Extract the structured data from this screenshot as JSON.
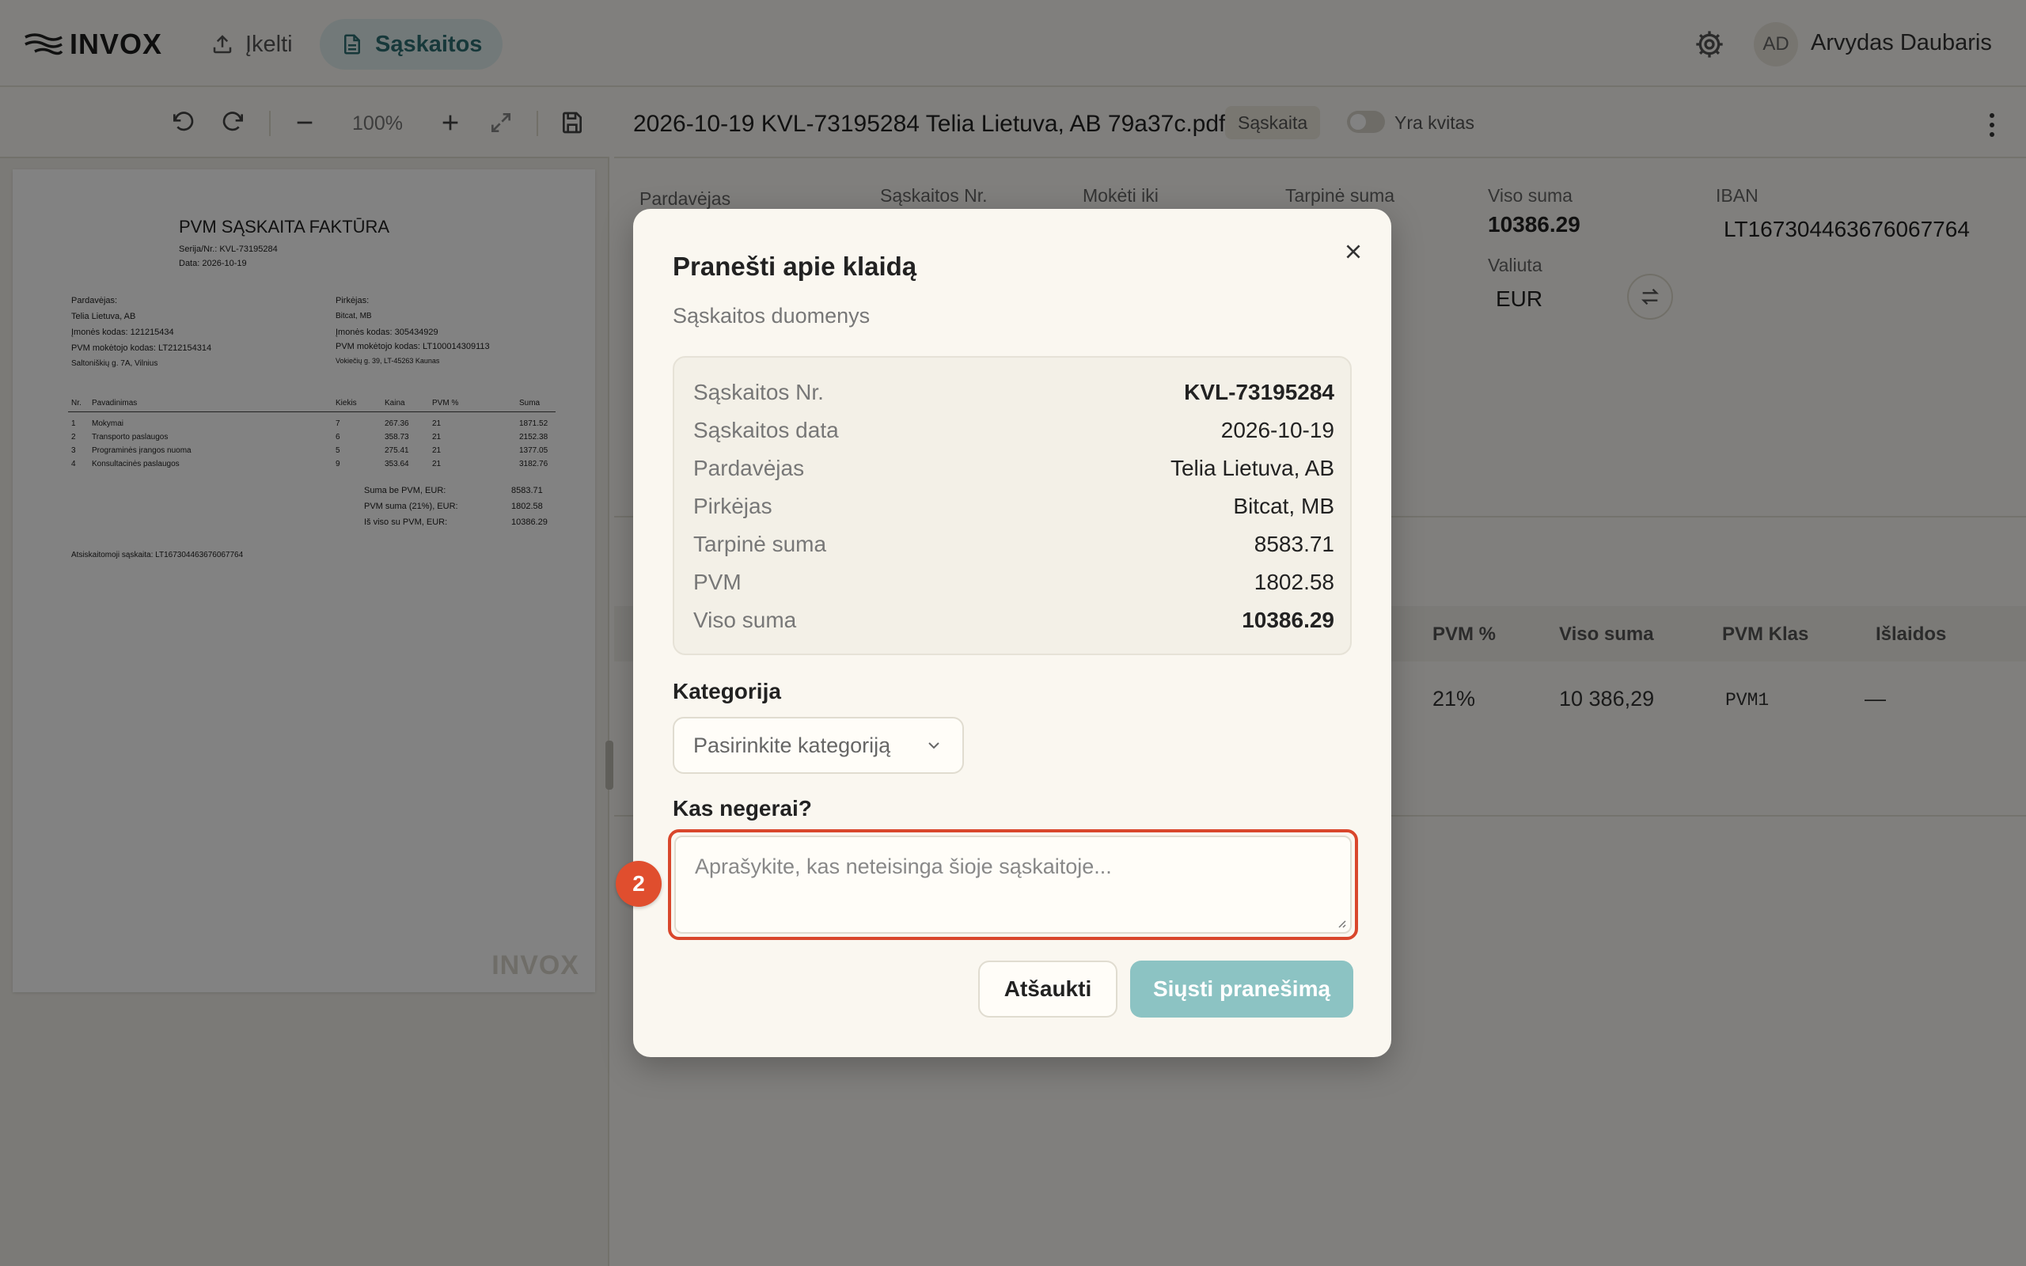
{
  "app": {
    "name": "INVOX"
  },
  "nav": {
    "upload_label": "Įkelti",
    "invoices_label": "Sąskaitos"
  },
  "user": {
    "initials": "AD",
    "name": "Arvydas Daubaris"
  },
  "viewer": {
    "zoom": "100%"
  },
  "pdf": {
    "title": "PVM SĄSKAITA FAKTŪRA",
    "series": "Serija/Nr.: KVL-73195284",
    "date": "Data: 2026-10-19",
    "seller_head": "Pardavėjas:",
    "seller_name": "Telia Lietuva, AB",
    "seller_code": "Įmonės kodas: 121215434",
    "seller_vat": "PVM mokėtojo kodas: LT212154314",
    "seller_addr": "Saltoniškių g. 7A, Vilnius",
    "buyer_head": "Pirkėjas:",
    "buyer_name": "Bitcat, MB",
    "buyer_code": "Įmonės kodas: 305434929",
    "buyer_vat": "PVM mokėtojo kodas: LT100014309113",
    "buyer_addr": "Vokiečių g. 39, LT-45263 Kaunas",
    "columns": [
      "Nr.",
      "Pavadinimas",
      "Kiekis",
      "Kaina",
      "PVM %",
      "Suma"
    ],
    "rows": [
      [
        "1",
        "Mokymai",
        "7",
        "267.36",
        "21",
        "1871.52"
      ],
      [
        "2",
        "Transporto paslaugos",
        "6",
        "358.73",
        "21",
        "2152.38"
      ],
      [
        "3",
        "Programinės įrangos nuoma",
        "5",
        "275.41",
        "21",
        "1377.05"
      ],
      [
        "4",
        "Konsultacinės paslaugos",
        "9",
        "353.64",
        "21",
        "3182.76"
      ]
    ],
    "totals": [
      [
        "Suma be PVM, EUR:",
        "8583.71"
      ],
      [
        "PVM suma (21%), EUR:",
        "1802.58"
      ],
      [
        "Iš viso su PVM, EUR:",
        "10386.29"
      ]
    ],
    "account": "Atsiskaitomoji sąskaita: LT167304463676067764",
    "watermark": "INVOX"
  },
  "document": {
    "file_name": "2026-10-19 KVL-73195284 Telia Lietuva, AB 79a37c.pdf",
    "badge": "Sąskaita",
    "receipt_toggle_label": "Yra kvitas"
  },
  "fields": {
    "seller_label": "Pardavėjas",
    "invoice_no_label": "Sąskaitos Nr.",
    "due_label": "Mokėti iki",
    "subtotal_label": "Tarpinė suma",
    "total_label": "Viso suma",
    "total_value": "10386.29",
    "iban_label": "IBAN",
    "iban_value": "LT167304463676067764",
    "currency_label": "Valiuta",
    "currency_value": "EUR"
  },
  "table": {
    "headers": [
      "PVM %",
      "Viso suma",
      "PVM Klas",
      "Išlaidos"
    ],
    "row": [
      "21%",
      "10 386,29",
      "PVM1",
      "—"
    ]
  },
  "modal": {
    "title": "Pranešti apie klaidą",
    "subtitle": "Sąskaitos duomenys",
    "summary": [
      {
        "label": "Sąskaitos Nr.",
        "value": "KVL-73195284"
      },
      {
        "label": "Sąskaitos data",
        "value": "2026-10-19"
      },
      {
        "label": "Pardavėjas",
        "value": "Telia Lietuva, AB"
      },
      {
        "label": "Pirkėjas",
        "value": "Bitcat, MB"
      },
      {
        "label": "Tarpinė suma",
        "value": "8583.71"
      },
      {
        "label": "PVM",
        "value": "1802.58"
      },
      {
        "label": "Viso suma",
        "value": "10386.29"
      }
    ],
    "category_label": "Kategorija",
    "category_placeholder": "Pasirinkite kategoriją",
    "what_label": "Kas negerai?",
    "textarea_placeholder": "Aprašykite, kas neteisinga šioje sąskaitoje...",
    "cancel_label": "Atšaukti",
    "send_label": "Siųsti pranešimą",
    "step_badge": "2"
  },
  "colors": {
    "accent": "#2d6f73",
    "send_button": "#8cc3c3",
    "highlight": "#d9472c"
  }
}
